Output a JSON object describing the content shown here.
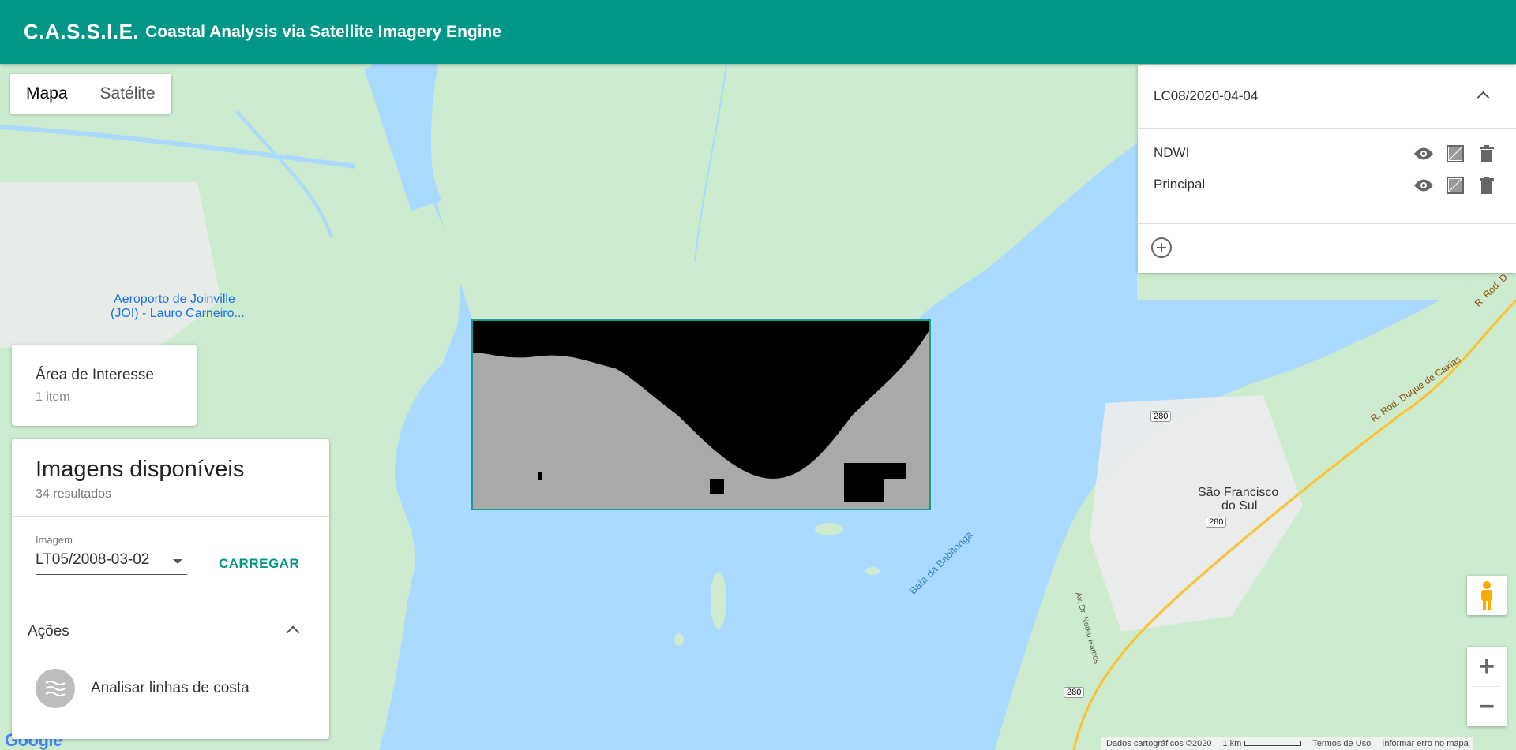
{
  "app": {
    "brand": "C.A.S.S.I.E.",
    "subtitle": "Coastal Analysis via Satellite Imagery Engine"
  },
  "map_type": {
    "options": [
      "Mapa",
      "Satélite"
    ],
    "selected": "Mapa"
  },
  "map_labels": {
    "airport": "Aeroporto de Joinville",
    "airport_2": "(JOI) - Lauro Carneiro...",
    "bay": "Baía da Babitonga",
    "city": "São Francisco",
    "city_2": "do Sul",
    "road_280_a": "280",
    "road_280_b": "280",
    "road_280_c": "280",
    "road_duque": "R. Rod. Duque de Caxias",
    "road_duque_2": "R. Rod. D",
    "road_nereu": "Av. Dr. Nereu Ramos"
  },
  "aoi_card": {
    "title": "Área de Interesse",
    "subtitle": "1 item"
  },
  "images_card": {
    "title": "Imagens disponíveis",
    "results": "34 resultados",
    "select_label": "Imagem",
    "select_value": "LT05/2008-03-02",
    "load_button": "CARREGAR",
    "actions_title": "Ações",
    "action_item": "Analisar linhas de costa"
  },
  "layers_panel": {
    "title": "LC08/2020-04-04",
    "layers": [
      {
        "name": "NDWI"
      },
      {
        "name": "Principal"
      }
    ]
  },
  "footer": {
    "data": "Dados cartográficos ©2020",
    "scale": "1 km",
    "terms": "Termos de Uso",
    "report": "Informar erro no mapa"
  },
  "google_logo": "Google",
  "colors": {
    "primary": "#009688",
    "water": "#aadaff",
    "land": "#cdebcf",
    "urban": "#ececec"
  }
}
